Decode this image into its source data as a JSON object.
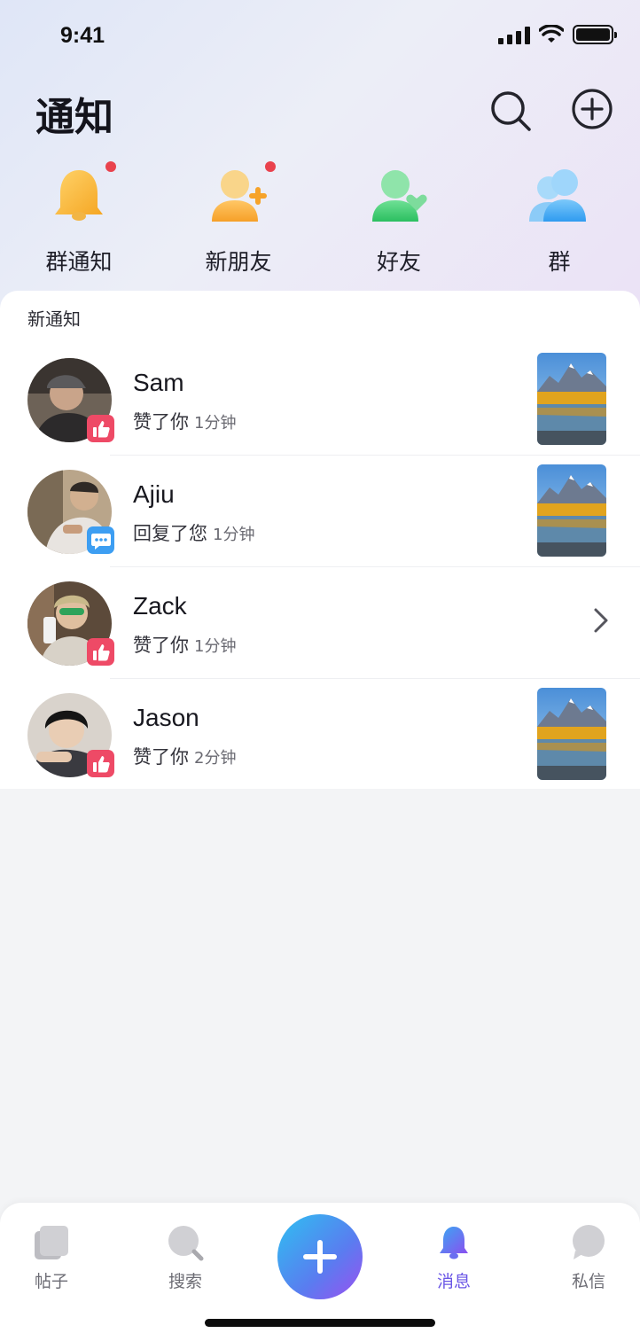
{
  "status_bar": {
    "time": "9:41"
  },
  "header": {
    "title": "通知",
    "search_icon": "search-icon",
    "add_icon": "plus-circle-icon"
  },
  "quick_nav": [
    {
      "label": "群通知",
      "icon": "bell-icon",
      "color": "#f6b73c",
      "has_dot": true
    },
    {
      "label": "新朋友",
      "icon": "add-friend-icon",
      "color": "#f6a32a",
      "has_dot": true
    },
    {
      "label": "好友",
      "icon": "friend-heart-icon",
      "color": "#33c46a",
      "has_dot": false
    },
    {
      "label": "群",
      "icon": "group-icon",
      "color": "#3aa7f2",
      "has_dot": false
    }
  ],
  "notifications": {
    "section_title": "新通知",
    "items": [
      {
        "name": "Sam",
        "action": "赞了你",
        "time": "1分钟",
        "badge": "like-icon",
        "has_thumb": true
      },
      {
        "name": "Ajiu",
        "action": "回复了您",
        "time": "1分钟",
        "badge": "comment-icon",
        "has_thumb": true
      },
      {
        "name": "Zack",
        "action": "赞了你",
        "time": "1分钟",
        "badge": "like-icon",
        "has_thumb": false
      },
      {
        "name": "Jason",
        "action": "赞了你",
        "time": "2分钟",
        "badge": "like-icon",
        "has_thumb": true
      }
    ]
  },
  "tabbar": {
    "tabs": [
      {
        "label": "帖子",
        "icon": "posts-icon",
        "active": false
      },
      {
        "label": "搜索",
        "icon": "search-icon",
        "active": false
      },
      {
        "label": "消息",
        "icon": "bell-icon",
        "active": true
      },
      {
        "label": "私信",
        "icon": "chat-bubble-icon",
        "active": false
      }
    ],
    "fab_icon": "plus-icon",
    "accent": "#6a56e6"
  },
  "colors": {
    "like": "#ee4a66",
    "comment": "#3d9ef2",
    "notification_dot": "#e9424d"
  }
}
